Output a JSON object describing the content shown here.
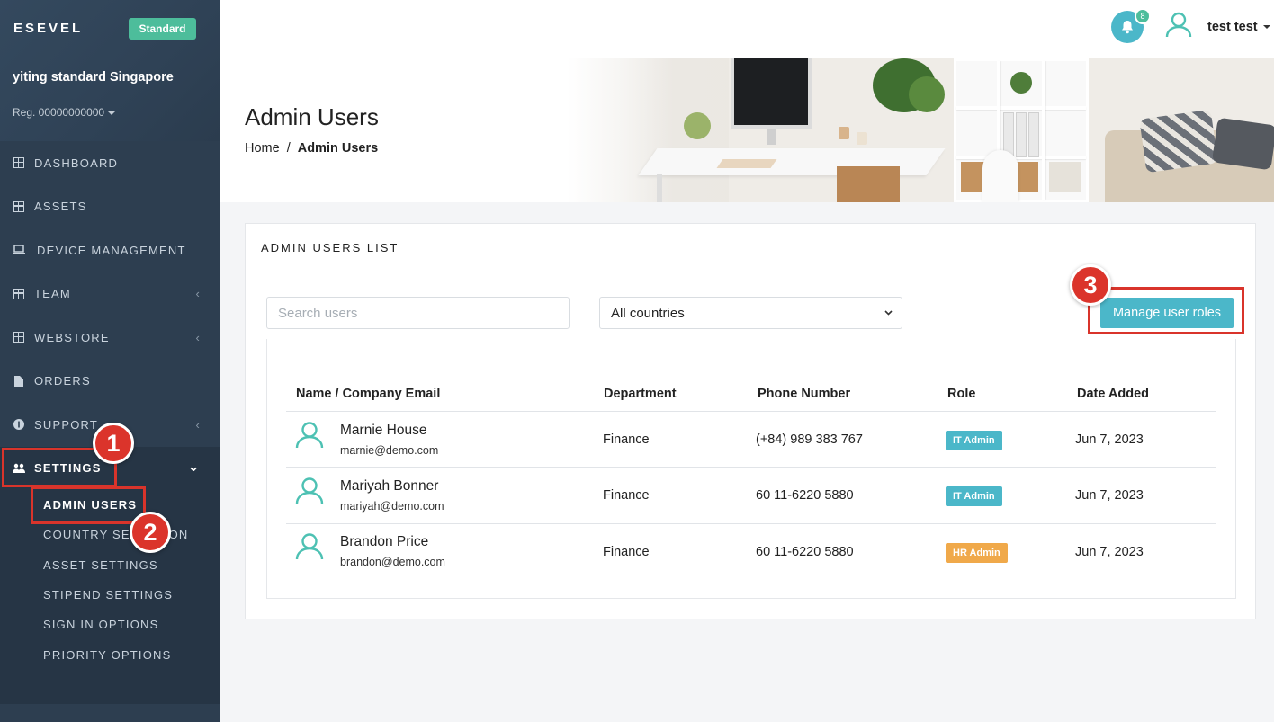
{
  "brand": {
    "name": "ESEVEL",
    "plan": "Standard"
  },
  "org": {
    "name": "yiting standard Singapore",
    "reg": "Reg. 00000000000"
  },
  "nav": [
    {
      "label": "DASHBOARD"
    },
    {
      "label": "ASSETS"
    },
    {
      "label": "DEVICE MANAGEMENT"
    },
    {
      "label": "TEAM",
      "chevron": "‹"
    },
    {
      "label": "WEBSTORE",
      "chevron": "‹"
    },
    {
      "label": "ORDERS"
    },
    {
      "label": "SUPPORT",
      "chevron": "‹"
    },
    {
      "label": "SETTINGS",
      "chevron": "⌄"
    }
  ],
  "settings_sub": [
    "ADMIN USERS",
    "COUNTRY SELECTION",
    "ASSET SETTINGS",
    "STIPEND SETTINGS",
    "SIGN IN OPTIONS",
    "PRIORITY OPTIONS"
  ],
  "header": {
    "notifications": "8",
    "user": "test test"
  },
  "page": {
    "title": "Admin Users",
    "crumb_home": "Home",
    "crumb_sep": "/",
    "crumb_current": "Admin Users"
  },
  "card": {
    "title": "ADMIN USERS LIST",
    "search_placeholder": "Search users",
    "country": "All countries",
    "manage_button": "Manage user roles"
  },
  "table": {
    "headers": [
      "Name / Company Email",
      "Department",
      "Phone Number",
      "Role",
      "Date Added"
    ],
    "rows": [
      {
        "name": "Marnie House",
        "email": "marnie@demo.com",
        "department": "Finance",
        "phone": "(+84) 989 383 767",
        "role": "IT Admin",
        "date": "Jun 7, 2023"
      },
      {
        "name": "Mariyah Bonner",
        "email": "mariyah@demo.com",
        "department": "Finance",
        "phone": "60 11-6220 5880",
        "role": "IT Admin",
        "date": "Jun 7, 2023"
      },
      {
        "name": "Brandon Price",
        "email": "brandon@demo.com",
        "department": "Finance",
        "phone": "60 11-6220 5880",
        "role": "HR Admin",
        "date": "Jun 7, 2023"
      }
    ]
  },
  "annotations": [
    "1",
    "2",
    "3"
  ],
  "colors": {
    "sidebar": "#2d3e50",
    "accent": "#4bb7c9",
    "green": "#4dbd9b",
    "it_admin": "#4bb7c9",
    "hr_admin": "#f0a94a",
    "annotation": "#db342b"
  },
  "icons": {
    "nav": [
      "grid-icon",
      "grid-icon",
      "laptop-icon",
      "grid-icon",
      "grid-icon",
      "file-icon",
      "info-icon",
      "users-icon"
    ]
  }
}
